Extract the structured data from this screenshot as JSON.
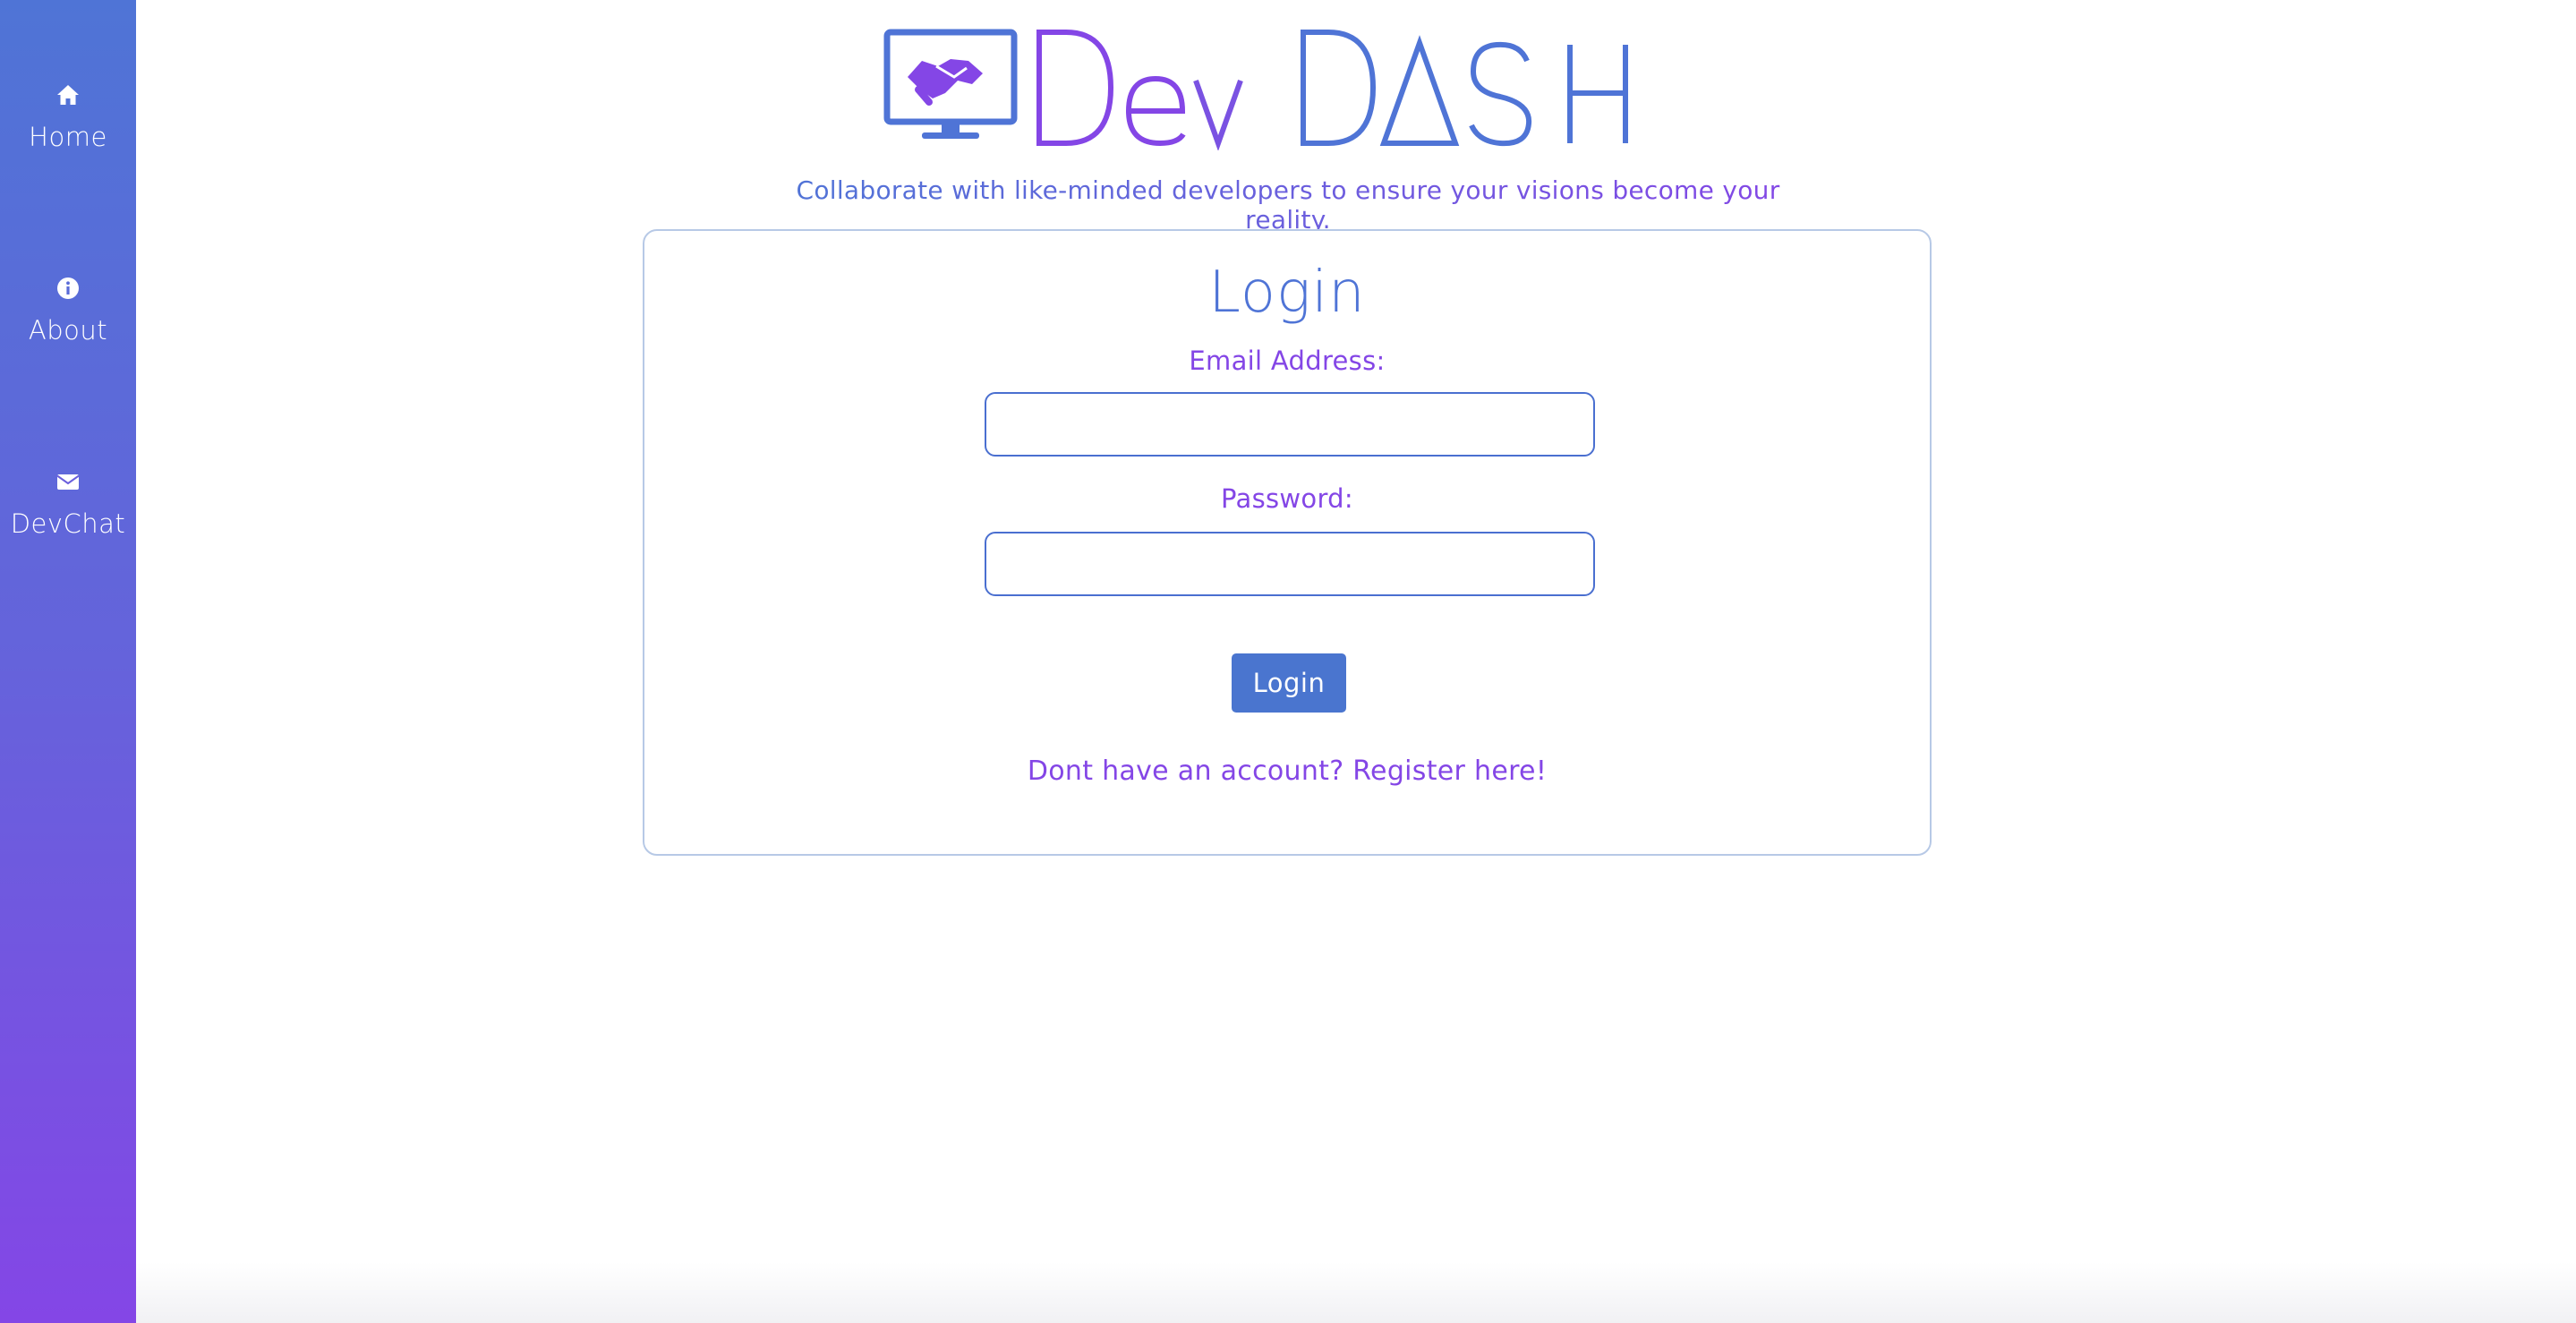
{
  "sidebar": {
    "items": [
      {
        "label": "Home",
        "icon": "home-icon"
      },
      {
        "label": "About",
        "icon": "info-icon"
      },
      {
        "label": "DevChat",
        "icon": "envelope-icon"
      }
    ]
  },
  "logo": {
    "text": "DevDash",
    "icon": "handshake-monitor-icon"
  },
  "tagline": "Collaborate with like-minded developers to ensure your visions become your reality.",
  "login_card": {
    "title": "Login",
    "email_label": "Email Address:",
    "email_value": "",
    "password_label": "Password:",
    "password_value": "",
    "submit_label": "Login",
    "register_link": "Dont have an account? Register here!"
  },
  "colors": {
    "blue": "#4f74d6",
    "purple": "#8446e6",
    "card_border": "#b7c9e6"
  }
}
